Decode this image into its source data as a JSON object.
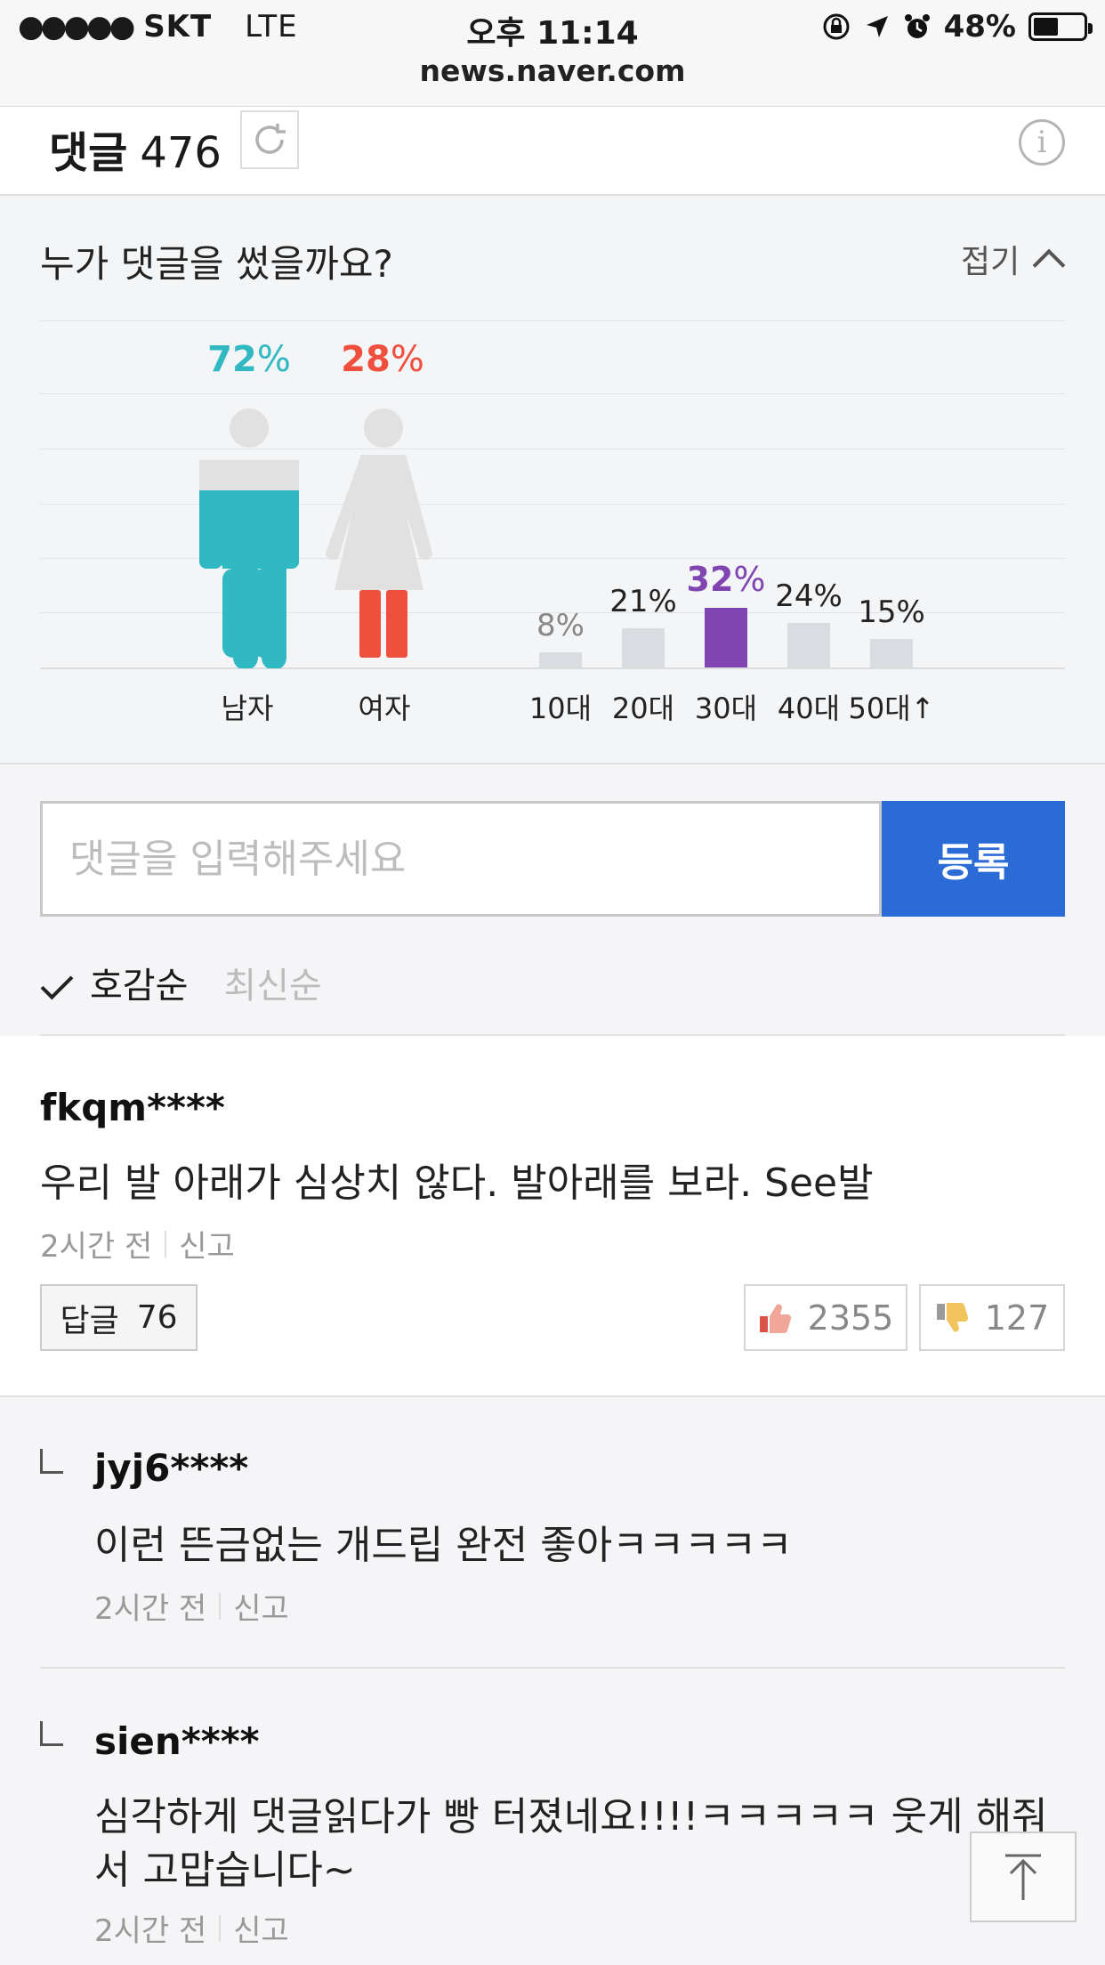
{
  "status_bar": {
    "signal": "●●●●●",
    "carrier": "SKT",
    "network": "LTE",
    "time": "오후 11:14",
    "battery": "48%",
    "url": "news.naver.com"
  },
  "comments_header": {
    "label": "댓글",
    "count": "476"
  },
  "stats": {
    "question": "누가 댓글을 썼을까요?",
    "fold_label": "접기",
    "colors": {
      "male": "#30b8c3",
      "female": "#ef4f3d",
      "highlight": "#8045b1",
      "neutral": "#d9dde2"
    },
    "gender": [
      {
        "label": "남자",
        "pct": "72",
        "unit": "%"
      },
      {
        "label": "여자",
        "pct": "28",
        "unit": "%"
      }
    ],
    "age": [
      {
        "label": "10대",
        "pct_label": "8%"
      },
      {
        "label": "20대",
        "pct_label": "21%"
      },
      {
        "label": "30대",
        "pct_label": "32",
        "unit": "%"
      },
      {
        "label": "40대",
        "pct_label": "24%"
      },
      {
        "label": "50대↑",
        "pct_label": "15%"
      }
    ]
  },
  "chart_data": {
    "type": "bar",
    "categories": [
      "10대",
      "20대",
      "30대",
      "40대",
      "50대↑"
    ],
    "values": [
      8,
      21,
      32,
      24,
      15
    ],
    "gender": {
      "categories": [
        "남자",
        "여자"
      ],
      "values": [
        72,
        28
      ]
    }
  },
  "composer": {
    "placeholder": "댓글을 입력해주세요",
    "submit_label": "등록"
  },
  "sort": {
    "active": "호감순",
    "inactive": "최신순"
  },
  "comment": {
    "user": "fkqm****",
    "text": "우리 발 아래가 심상치 않다. 발아래를 보라. See발",
    "time": "2시간 전",
    "report": "신고",
    "reply_label": "답글",
    "reply_count": "76",
    "likes": "2355",
    "dislikes": "127"
  },
  "replies": [
    {
      "user": "jyj6****",
      "text": "이런 뜬금없는 개드립 완전 좋아ㅋㅋㅋㅋㅋ",
      "time": "2시간 전",
      "report": "신고"
    },
    {
      "user": "sien****",
      "text_line1": "심각하게 댓글읽다가 빵 터졌네요!!!!ㅋㅋㅋㅋㅋ 웃게 해줘",
      "text_line2": "서 고맙습니다~",
      "time": "2시간 전",
      "report": "신고"
    }
  ]
}
